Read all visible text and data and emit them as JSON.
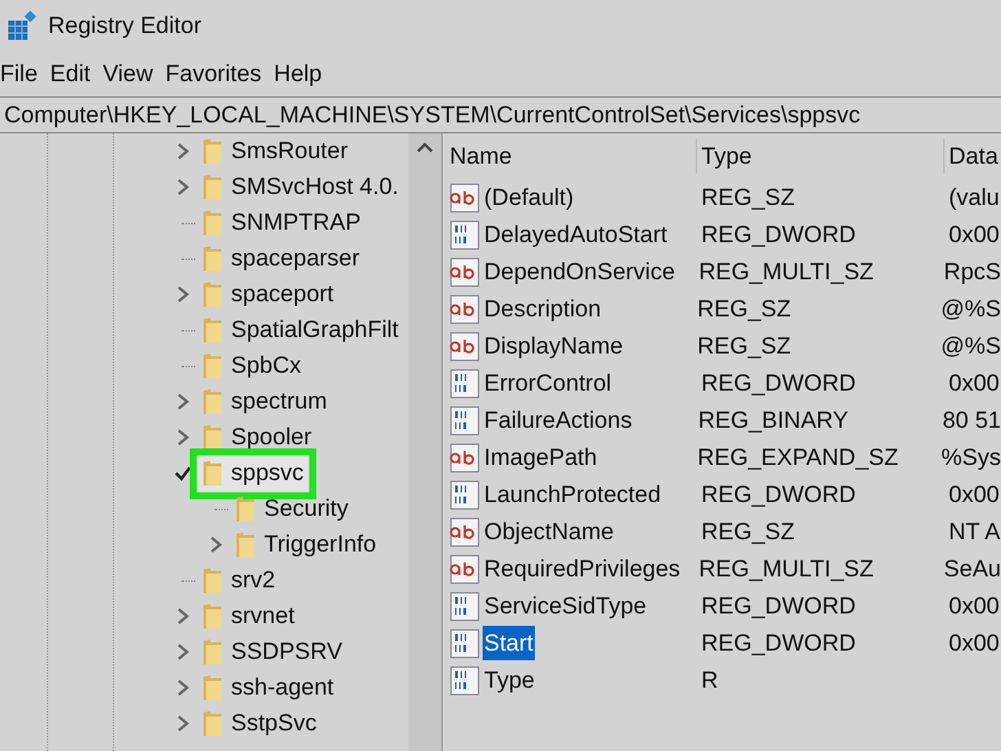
{
  "window": {
    "title": "Registry Editor"
  },
  "menu": [
    "File",
    "Edit",
    "View",
    "Favorites",
    "Help"
  ],
  "address": "Computer\\HKEY_LOCAL_MACHINE\\SYSTEM\\CurrentControlSet\\Services\\sppsvc",
  "tree": [
    {
      "label": "SmsRouter",
      "expandable": true,
      "expanded": false,
      "selected": false
    },
    {
      "label": "SMSvcHost 4.0.",
      "expandable": true,
      "expanded": false,
      "selected": false
    },
    {
      "label": "SNMPTRAP",
      "expandable": false,
      "expanded": false,
      "selected": false
    },
    {
      "label": "spaceparser",
      "expandable": false,
      "expanded": false,
      "selected": false
    },
    {
      "label": "spaceport",
      "expandable": true,
      "expanded": false,
      "selected": false
    },
    {
      "label": "SpatialGraphFilt",
      "expandable": false,
      "expanded": false,
      "selected": false
    },
    {
      "label": "SpbCx",
      "expandable": false,
      "expanded": false,
      "selected": false
    },
    {
      "label": "spectrum",
      "expandable": true,
      "expanded": false,
      "selected": false
    },
    {
      "label": "Spooler",
      "expandable": true,
      "expanded": false,
      "selected": false
    },
    {
      "label": "sppsvc",
      "expandable": true,
      "expanded": true,
      "selected": true,
      "highlighted": true,
      "children": [
        {
          "label": "Security",
          "expandable": false,
          "expanded": false,
          "selected": false
        },
        {
          "label": "TriggerInfo",
          "expandable": true,
          "expanded": false,
          "selected": false
        }
      ]
    },
    {
      "label": "srv2",
      "expandable": false,
      "expanded": false,
      "selected": false
    },
    {
      "label": "srvnet",
      "expandable": true,
      "expanded": false,
      "selected": false
    },
    {
      "label": "SSDPSRV",
      "expandable": true,
      "expanded": false,
      "selected": false
    },
    {
      "label": "ssh-agent",
      "expandable": true,
      "expanded": false,
      "selected": false
    },
    {
      "label": "SstpSvc",
      "expandable": true,
      "expanded": false,
      "selected": false
    }
  ],
  "table": {
    "columns": [
      "Name",
      "Type",
      "Data"
    ],
    "rows": [
      {
        "kind": "string",
        "name": "(Default)",
        "type": "REG_SZ",
        "data": "(valu",
        "selected": false
      },
      {
        "kind": "binary",
        "name": "DelayedAutoStart",
        "type": "REG_DWORD",
        "data": "0x00",
        "selected": false
      },
      {
        "kind": "string",
        "name": "DependOnService",
        "type": "REG_MULTI_SZ",
        "data": "RpcS",
        "selected": false
      },
      {
        "kind": "string",
        "name": "Description",
        "type": "REG_SZ",
        "data": "@%S",
        "selected": false
      },
      {
        "kind": "string",
        "name": "DisplayName",
        "type": "REG_SZ",
        "data": "@%S",
        "selected": false
      },
      {
        "kind": "binary",
        "name": "ErrorControl",
        "type": "REG_DWORD",
        "data": "0x00",
        "selected": false
      },
      {
        "kind": "binary",
        "name": "FailureActions",
        "type": "REG_BINARY",
        "data": "80 51",
        "selected": false
      },
      {
        "kind": "string",
        "name": "ImagePath",
        "type": "REG_EXPAND_SZ",
        "data": "%Sys",
        "selected": false
      },
      {
        "kind": "binary",
        "name": "LaunchProtected",
        "type": "REG_DWORD",
        "data": "0x00",
        "selected": false
      },
      {
        "kind": "string",
        "name": "ObjectName",
        "type": "REG_SZ",
        "data": "NT A",
        "selected": false
      },
      {
        "kind": "string",
        "name": "RequiredPrivileges",
        "type": "REG_MULTI_SZ",
        "data": "SeAu",
        "selected": false
      },
      {
        "kind": "binary",
        "name": "ServiceSidType",
        "type": "REG_DWORD",
        "data": "0x00",
        "selected": false
      },
      {
        "kind": "binary",
        "name": "Start",
        "type": "REG_DWORD",
        "data": "0x00",
        "selected": true
      },
      {
        "kind": "binary",
        "name": "Type",
        "type": "R",
        "selected": false
      }
    ]
  }
}
